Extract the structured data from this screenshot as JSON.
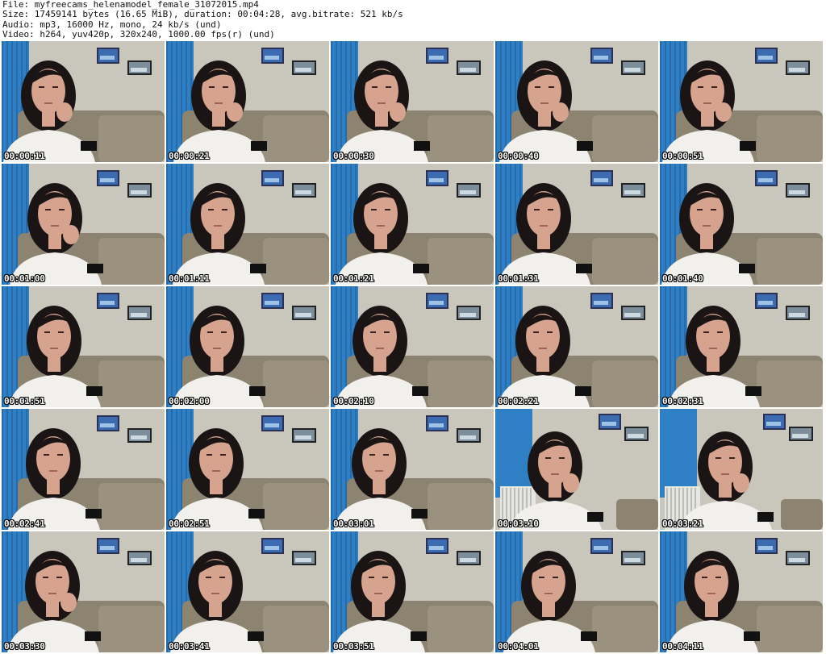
{
  "header": {
    "file": "File: myfreecams_helenamodel_female_31072015.mp4",
    "size": "Size: 17459141 bytes (16.65 MiB), duration: 00:04:28, avg.bitrate: 521 kb/s",
    "audio": "Audio: mp3, 16000 Hz, mono, 24 kb/s (und)",
    "video": "Video: h264, yuv420p, 320x240, 1000.00 fps(r) (und)"
  },
  "colors": {
    "wall": "#c9c6bb",
    "blinds": "#2f7fc4",
    "sofa": "#8c8470",
    "hair": "#1a1514",
    "skin": "#d6a48e",
    "shirt": "#f2f0ec",
    "timestamp": "#ffffff"
  },
  "thumbnails": [
    {
      "timestamp": "00:00:11",
      "variant": "desk"
    },
    {
      "timestamp": "00:00:21",
      "variant": "desk"
    },
    {
      "timestamp": "00:00:30",
      "variant": "desk"
    },
    {
      "timestamp": "00:00:40",
      "variant": "desk"
    },
    {
      "timestamp": "00:00:51",
      "variant": "desk"
    },
    {
      "timestamp": "00:01:00",
      "variant": "desk"
    },
    {
      "timestamp": "00:01:11",
      "variant": "desk"
    },
    {
      "timestamp": "00:01:21",
      "variant": "desk"
    },
    {
      "timestamp": "00:01:31",
      "variant": "desk"
    },
    {
      "timestamp": "00:01:40",
      "variant": "desk"
    },
    {
      "timestamp": "00:01:51",
      "variant": "desk"
    },
    {
      "timestamp": "00:02:00",
      "variant": "desk"
    },
    {
      "timestamp": "00:02:10",
      "variant": "desk"
    },
    {
      "timestamp": "00:02:21",
      "variant": "desk"
    },
    {
      "timestamp": "00:02:31",
      "variant": "desk"
    },
    {
      "timestamp": "00:02:41",
      "variant": "desk"
    },
    {
      "timestamp": "00:02:51",
      "variant": "desk"
    },
    {
      "timestamp": "00:03:01",
      "variant": "desk"
    },
    {
      "timestamp": "00:03:10",
      "variant": "radiator"
    },
    {
      "timestamp": "00:03:21",
      "variant": "radiator"
    },
    {
      "timestamp": "00:03:30",
      "variant": "desk"
    },
    {
      "timestamp": "00:03:41",
      "variant": "desk"
    },
    {
      "timestamp": "00:03:51",
      "variant": "desk"
    },
    {
      "timestamp": "00:04:01",
      "variant": "desk"
    },
    {
      "timestamp": "00:04:11",
      "variant": "desk"
    }
  ]
}
